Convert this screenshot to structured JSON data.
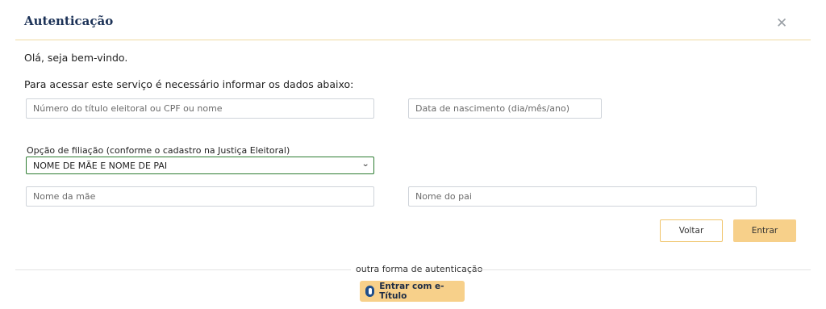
{
  "dialog": {
    "title": "Autenticação",
    "close_icon": "close-icon",
    "welcome": "Olá, seja bem-vindo.",
    "instructions": "Para acessar este serviço é necessário informar os dados abaixo:"
  },
  "form": {
    "titulo": {
      "placeholder": "Número do título eleitoral ou CPF ou nome",
      "value": ""
    },
    "nascimento": {
      "placeholder": "Data de nascimento (dia/mês/ano)",
      "value": ""
    },
    "filiacao": {
      "label": "Opção de filiação (conforme o cadastro na Justiça Eleitoral)",
      "selected": "NOME DE MÃE E NOME DE PAI"
    },
    "mae": {
      "placeholder": "Nome da mãe",
      "value": ""
    },
    "pai": {
      "placeholder": "Nome do pai",
      "value": ""
    }
  },
  "actions": {
    "voltar": "Voltar",
    "entrar": "Entrar"
  },
  "alternative": {
    "divider_text": "outra forma de autenticação",
    "etitulo_label": "Entrar com e-Título",
    "etitulo_icon": "e-titulo-icon"
  },
  "colors": {
    "title": "#1c3257",
    "accent": "#f7d08a",
    "select_border": "#2e7d32"
  }
}
